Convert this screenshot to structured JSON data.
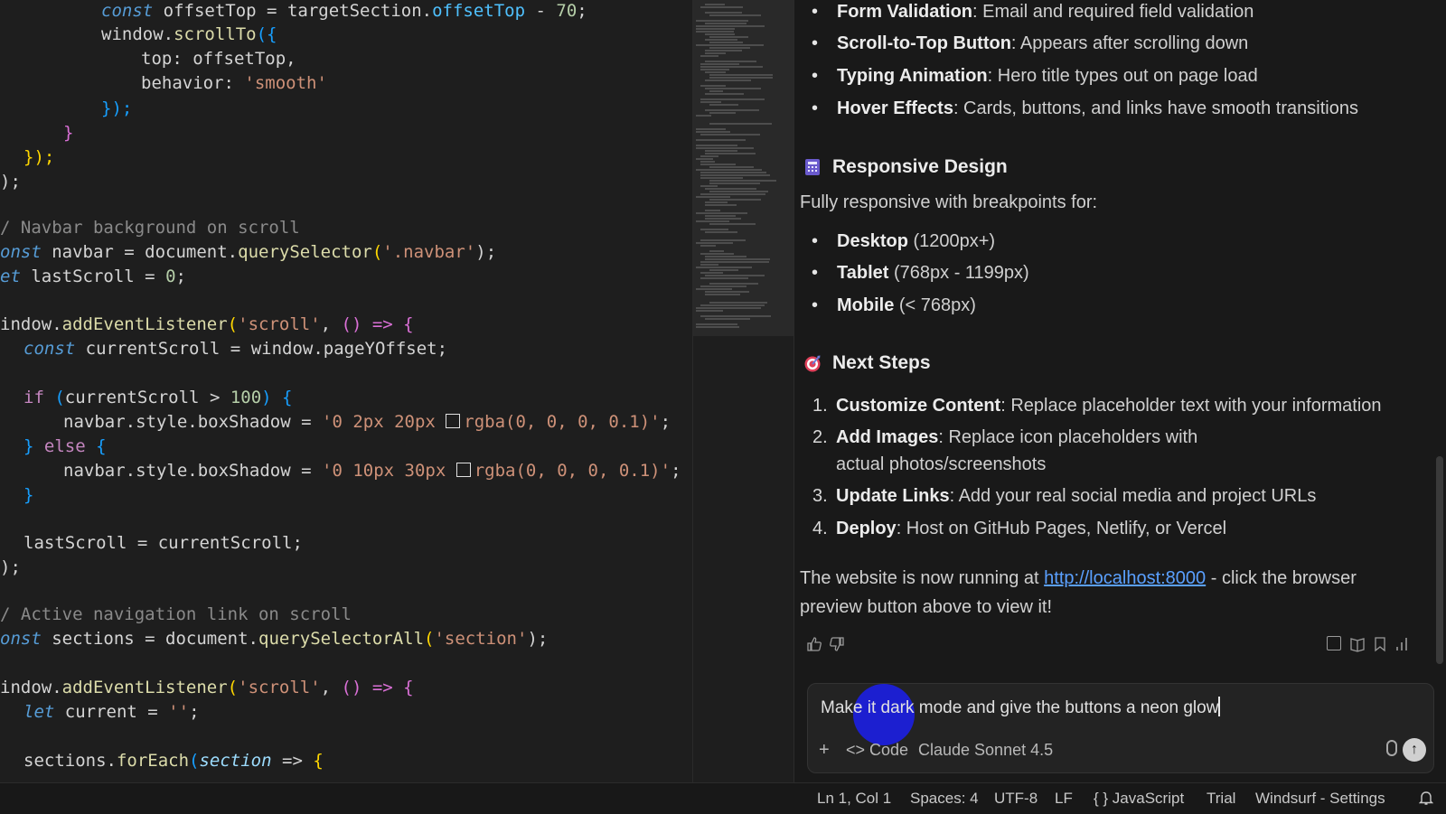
{
  "editor": {
    "lines": {
      "l1": {
        "kw": "const",
        "a": " offsetTop ",
        "eq": "=",
        "b": " targetSection.",
        "prop": "offsetTop",
        "c": " - ",
        "num": "70",
        "d": ";"
      },
      "l2": {
        "a": "window.",
        "fn": "scrollTo",
        "p": "({"
      },
      "l3": {
        "a": "top: offsetTop,"
      },
      "l4": {
        "a": "behavior: ",
        "str": "'smooth'"
      },
      "l5": {
        "p": "});"
      },
      "l6": {
        "p": "}"
      },
      "l7": {
        "p": "});"
      },
      "l8": {
        "p": ");"
      },
      "l9": {
        "cm": "/ Navbar background on scroll"
      },
      "l10": {
        "kw": "onst",
        "a": " navbar ",
        "eq": "=",
        "b": " document.",
        "fn": "querySelector",
        "p": "(",
        "str": "'.navbar'",
        "q": ");"
      },
      "l11": {
        "kw": "et",
        "a": " lastScroll ",
        "eq": "=",
        "num": " 0",
        "d": ";"
      },
      "l12": {
        "a": "indow.",
        "fn": "addEventListener",
        "p": "(",
        "str": "'scroll'",
        "b": ", ",
        "q": "() => {"
      },
      "l13": {
        "kw": "const",
        "a": " currentScroll ",
        "eq": "=",
        "b": " window.pageYOffset;"
      },
      "l14": {
        "ctl": "if",
        "p": " (",
        "a": "currentScroll ",
        "op": ">",
        "num": " 100",
        "q": ") {"
      },
      "l15": {
        "a": "navbar.style.boxShadow ",
        "eq": "=",
        "str1": " '0 2px 20px ",
        "str2": "rgba(0, 0, 0, 0.1)'",
        "d": ";"
      },
      "l16": {
        "p": "} ",
        "ctl": "else",
        "q": " {"
      },
      "l17": {
        "a": "navbar.style.boxShadow ",
        "eq": "=",
        "str1": " '0 10px 30px ",
        "str2": "rgba(0, 0, 0, 0.1)'",
        "d": ";"
      },
      "l18": {
        "p": "}"
      },
      "l19": {
        "a": "lastScroll ",
        "eq": "=",
        "b": " currentScroll;"
      },
      "l20": {
        "p": ");"
      },
      "l21": {
        "cm": "/ Active navigation link on scroll"
      },
      "l22": {
        "kw": "onst",
        "a": " sections ",
        "eq": "=",
        "b": " document.",
        "fn": "querySelectorAll",
        "p": "(",
        "str": "'section'",
        "q": ");"
      },
      "l23": {
        "a": "indow.",
        "fn": "addEventListener",
        "p": "(",
        "str": "'scroll'",
        "b": ", ",
        "q": "() => {"
      },
      "l24": {
        "kw": "let",
        "a": " current ",
        "eq": "=",
        "str": " ''",
        "d": ";"
      },
      "l25": {
        "a": "sections.",
        "fn": "forEach",
        "p": "(",
        "par": "section",
        "b": " => ",
        "q": "{"
      }
    }
  },
  "chat": {
    "features": [
      {
        "bold": "Form Validation",
        "rest": ": Email and required field validation"
      },
      {
        "bold": "Scroll-to-Top Button",
        "rest": ": Appears after scrolling down"
      },
      {
        "bold": "Typing Animation",
        "rest": ": Hero title types out on page load"
      },
      {
        "bold": "Hover Effects",
        "rest": ": Cards, buttons, and links have smooth transitions"
      }
    ],
    "responsive_heading": "Responsive Design",
    "responsive_intro": "Fully responsive with breakpoints for:",
    "breakpoints": [
      {
        "bold": "Desktop",
        "rest": " (1200px+)"
      },
      {
        "bold": "Tablet",
        "rest": " (768px - 1199px)"
      },
      {
        "bold": "Mobile",
        "rest": " (< 768px)"
      }
    ],
    "next_heading": "Next Steps",
    "steps": [
      {
        "num": "1.",
        "bold": "Customize Content",
        "rest": ": Replace placeholder text with your information"
      },
      {
        "num": "2.",
        "bold": "Add Images",
        "rest": ": Replace icon placeholders with actual photos/screenshots"
      },
      {
        "num": "3.",
        "bold": "Update Links",
        "rest": ": Add your real social media and project URLs"
      },
      {
        "num": "4.",
        "bold": "Deploy",
        "rest": ": Host on GitHub Pages, Netlify, or Vercel"
      }
    ],
    "running_pre": "The website is now running at ",
    "running_link": "http://localhost:8000",
    "running_post": " - click the browser preview button above to view it!",
    "input_value": "Make it dark mode and give the buttons a neon glow",
    "toolbar": {
      "plus": "+",
      "code": "<> Code",
      "model": "Claude Sonnet 4.5"
    }
  },
  "status": {
    "position": "Ln 1, Col 1",
    "spaces": "Spaces: 4",
    "encoding": "UTF-8",
    "eol": "LF",
    "language": "{ } JavaScript",
    "trial": "Trial",
    "settings": "Windsurf - Settings"
  },
  "colors": {
    "accent_cursor": "#1c20e0",
    "link": "#5aa0ff"
  }
}
